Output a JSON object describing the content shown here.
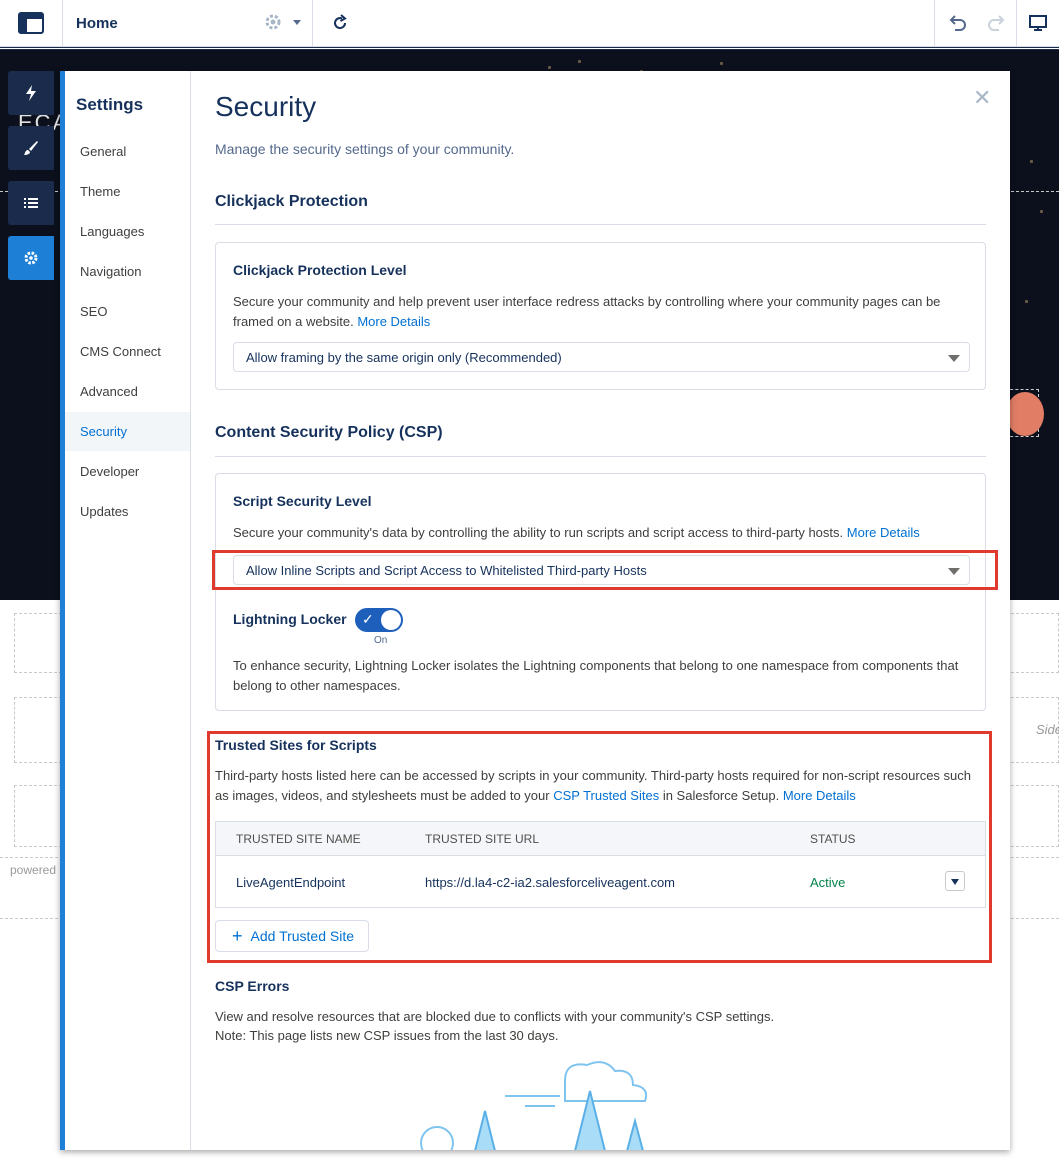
{
  "topbar": {
    "page_title": "Home"
  },
  "canvas": {
    "brand_text": "ECA",
    "side_label": "Side",
    "powered_text": "powered"
  },
  "settings_nav": {
    "heading": "Settings",
    "items": [
      "General",
      "Theme",
      "Languages",
      "Navigation",
      "SEO",
      "CMS Connect",
      "Advanced",
      "Security",
      "Developer",
      "Updates"
    ],
    "selected": "Security"
  },
  "page": {
    "title": "Security",
    "subtitle": "Manage the security settings of your community."
  },
  "clickjack": {
    "section_title": "Clickjack Protection",
    "card_title": "Clickjack Protection Level",
    "description": "Secure your community and help prevent user interface redress attacks by controlling where your community pages can be framed on a website.",
    "more_details": "More Details",
    "selected_option": "Allow framing by the same origin only (Recommended)"
  },
  "csp": {
    "section_title": "Content Security Policy (CSP)",
    "card_title": "Script Security Level",
    "description": "Secure your community's data by controlling the ability to run scripts and script access to third-party hosts.",
    "more_details": "More Details",
    "selected_option": "Allow Inline Scripts and Script Access to Whitelisted Third-party Hosts",
    "locker_label": "Lightning Locker",
    "locker_state": "On",
    "locker_on": true,
    "locker_description": "To enhance security, Lightning Locker isolates the Lightning components that belong to one namespace from components that belong to other namespaces."
  },
  "trusted_sites": {
    "title": "Trusted Sites for Scripts",
    "description_part1": "Third-party hosts listed here can be accessed by scripts in your community. Third-party hosts required for non-script resources such as images, videos, and stylesheets must be added to your",
    "csp_link": "CSP Trusted Sites",
    "description_part2": "in Salesforce Setup.",
    "more_details": "More Details",
    "columns": [
      "TRUSTED SITE NAME",
      "TRUSTED SITE URL",
      "STATUS"
    ],
    "rows": [
      {
        "name": "LiveAgentEndpoint",
        "url": "https://d.la4-c2-ia2.salesforceliveagent.com",
        "status": "Active"
      }
    ],
    "add_button": "Add Trusted Site"
  },
  "csp_errors": {
    "title": "CSP Errors",
    "line1": "View and resolve resources that are blocked due to conflicts with your community's CSP settings.",
    "line2": "Note: This page lists new CSP issues from the last 30 days."
  },
  "colors": {
    "accent": "#1e7fd6",
    "link": "#0070d2",
    "highlight_box": "#e03a2f",
    "status_active": "#04844b",
    "rail_dark": "#1b2b4b"
  }
}
